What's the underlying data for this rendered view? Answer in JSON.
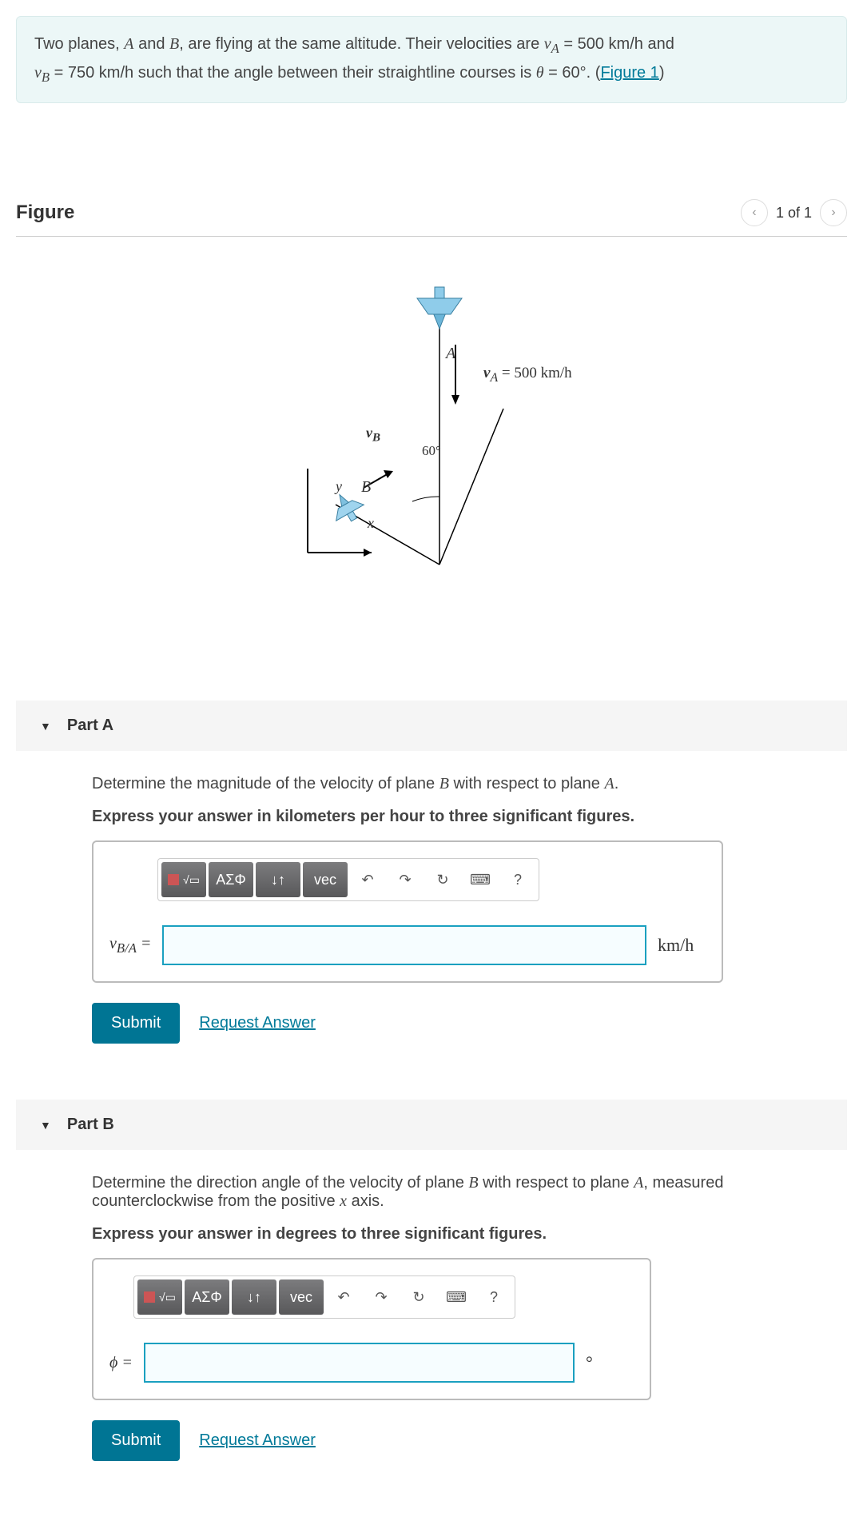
{
  "problem": {
    "text_prefix": "Two planes, ",
    "A": "A",
    "and": " and ",
    "B": "B",
    "text_mid": ", are flying at the same altitude. Their velocities are ",
    "vA_sym": "v",
    "vA_sub": "A",
    "eq": " = ",
    "vA_val": "500",
    "unit_km": " km/h",
    "and2": " and ",
    "vB_sym": "v",
    "vB_sub": "B",
    "vB_val": "750",
    "text_angle": " such that the angle between their straightline courses is ",
    "theta": "θ",
    "theta_val": "60°",
    "period": ". (",
    "figure_link": "Figure 1",
    "close": ")"
  },
  "figure": {
    "title": "Figure",
    "pager": "1 of 1",
    "labels": {
      "A": "A",
      "vA": "v",
      "vA_sub": "A",
      "vA_eq": " = 500 km/h",
      "vB": "v",
      "vB_sub": "B",
      "B": "B",
      "angle": "60°",
      "y": "y",
      "x": "x"
    }
  },
  "partA": {
    "title": "Part A",
    "question_pre": "Determine the magnitude of the velocity of plane ",
    "B": "B",
    "question_mid": " with respect to plane ",
    "A": "A",
    "question_post": ".",
    "instruction": "Express your answer in kilometers per hour to three significant figures.",
    "input_label_v": "v",
    "input_label_sub": "B/A",
    "input_label_eq": " =",
    "unit": "km/h",
    "submit": "Submit",
    "request": "Request Answer"
  },
  "partB": {
    "title": "Part B",
    "question_pre": "Determine the direction angle of the velocity of plane ",
    "B": "B",
    "question_mid": " with respect to plane ",
    "A": "A",
    "question_post": ", measured counterclockwise from the positive ",
    "x": "x",
    "question_end": " axis.",
    "instruction": "Express your answer in degrees to three significant figures.",
    "input_label": "ϕ =",
    "unit": "°",
    "submit": "Submit",
    "request": "Request Answer"
  },
  "toolbar": {
    "templates": "▭",
    "sqrt": "√▭",
    "greek": "ΑΣΦ",
    "subsup": "↓↑",
    "vec": "vec",
    "undo": "↶",
    "redo": "↷",
    "reset": "↻",
    "keyboard": "⌨",
    "help": "?"
  }
}
